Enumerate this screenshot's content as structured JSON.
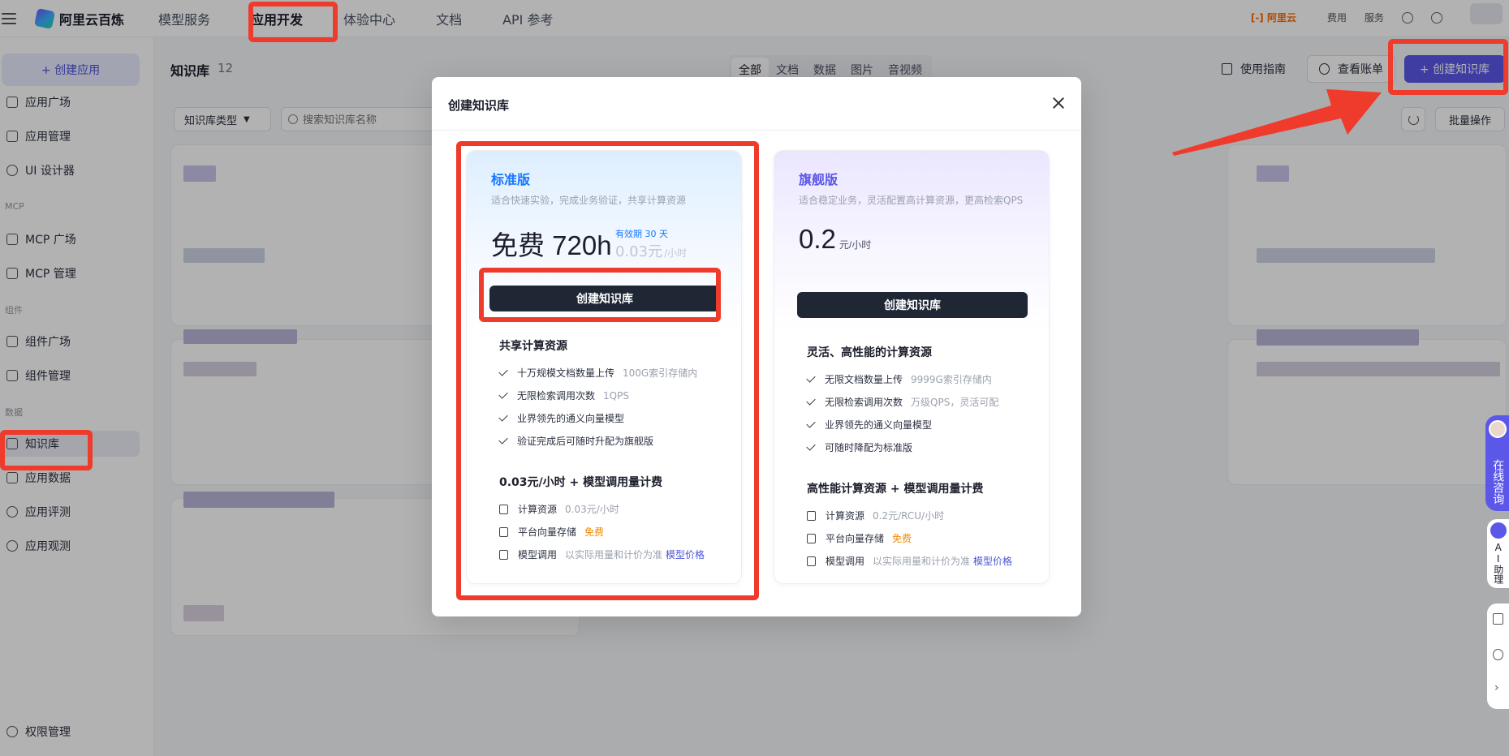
{
  "topbar": {
    "brand": "阿里云百炼",
    "nav": [
      "模型服务",
      "应用开发",
      "体验中心",
      "文档",
      "API 参考"
    ],
    "active_nav": "应用开发",
    "aliyun_logo": "[-] 阿里云",
    "links": [
      "费用",
      "服务"
    ]
  },
  "sidebar": {
    "create_button": "+ 创建应用",
    "items": [
      {
        "label": "应用广场",
        "icon": "grid-icon"
      },
      {
        "label": "应用管理",
        "icon": "apps-icon"
      },
      {
        "label": "UI 设计器",
        "icon": "palette-icon"
      }
    ],
    "group_mcp": "MCP",
    "mcp_items": [
      {
        "label": "MCP 广场",
        "icon": "bolt-icon"
      },
      {
        "label": "MCP 管理",
        "icon": "bolt-manage-icon"
      }
    ],
    "group_component": "组件",
    "component_items": [
      {
        "label": "组件广场",
        "icon": "puzzle-icon"
      },
      {
        "label": "组件管理",
        "icon": "puzzle-manage-icon"
      }
    ],
    "group_data": "数据",
    "data_items": [
      {
        "label": "知识库",
        "icon": "book-icon",
        "active": true
      },
      {
        "label": "应用数据",
        "icon": "chart-icon"
      },
      {
        "label": "应用评测",
        "icon": "compass-icon"
      },
      {
        "label": "应用观测",
        "icon": "pie-icon"
      }
    ],
    "bottom_item": {
      "label": "权限管理",
      "icon": "user-icon"
    }
  },
  "main": {
    "title": "知识库",
    "count": "12",
    "filter_tabs": [
      "全部",
      "文档",
      "数据",
      "图片",
      "音视频"
    ],
    "active_filter": "全部",
    "guide_button": "使用指南",
    "bill_button": "查看账单",
    "create_button": "+ 创建知识库",
    "kb_type_select": "知识库类型",
    "search_placeholder": "搜索知识库名称",
    "batch_button": "批量操作"
  },
  "modal": {
    "title": "创建知识库",
    "standard": {
      "name": "标准版",
      "desc": "适合快速实验，完成业务验证，共享计算资源",
      "price": "免费 720h",
      "validity": "有效期 30 天",
      "old_price": "0.03元",
      "old_price_unit": "/小时",
      "button": "创建知识库",
      "section1": "共享计算资源",
      "features": [
        {
          "text": "十万规模文档数量上传",
          "sub": "100G索引存储内"
        },
        {
          "text": "无限检索调用次数",
          "sub": "1QPS"
        },
        {
          "text": "业界领先的通义向量模型",
          "sub": ""
        },
        {
          "text": "验证完成后可随时升配为旗舰版",
          "sub": ""
        }
      ],
      "section2": "0.03元/小时 + 模型调用量计费",
      "billing": [
        {
          "label": "计算资源",
          "value": "0.03元/小时"
        },
        {
          "label": "平台向量存储",
          "value": "免费"
        },
        {
          "label": "模型调用",
          "value": "以实际用量和计价为准",
          "link": "模型价格"
        }
      ]
    },
    "pro": {
      "name": "旗舰版",
      "desc": "适合稳定业务，灵活配置高计算资源，更高检索QPS",
      "price": "0.2",
      "price_unit": "元/小时",
      "button": "创建知识库",
      "section1": "灵活、高性能的计算资源",
      "features": [
        {
          "text": "无限文档数量上传",
          "sub": "9999G索引存储内"
        },
        {
          "text": "无限检索调用次数",
          "sub": "万级QPS，灵活可配"
        },
        {
          "text": "业界领先的通义向量模型",
          "sub": ""
        },
        {
          "text": "可随时降配为标准版",
          "sub": ""
        }
      ],
      "section2": "高性能计算资源 + 模型调用量计费",
      "billing": [
        {
          "label": "计算资源",
          "value": "0.2元/RCU/小时"
        },
        {
          "label": "平台向量存储",
          "value": "免费"
        },
        {
          "label": "模型调用",
          "value": "以实际用量和计价为准",
          "link": "模型价格"
        }
      ]
    }
  },
  "floating": {
    "consult": "在线咨询",
    "ai_assistant": "AI助理"
  },
  "colors": {
    "accent": "#5b57e8",
    "standard_accent": "#1777ff",
    "annotation_red": "#ee3b2b",
    "free_orange": "#f28a00",
    "button_dark": "#1f2735"
  }
}
